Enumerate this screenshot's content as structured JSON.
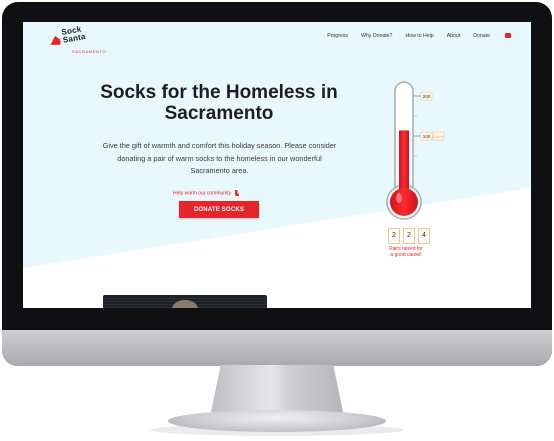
{
  "nav": {
    "logo": {
      "line1": "Sock",
      "line2": "Santa",
      "sub": "SACRAMENTO"
    },
    "links": [
      "Progress",
      "Why Donate?",
      "How to Help",
      "About",
      "Donate"
    ],
    "mail_icon": "envelope-icon"
  },
  "hero": {
    "title": "Socks for the Homeless in Sacramento",
    "description": "Give the gift of warmth and comfort this holiday season. Please consider donating a pair of warm socks to the homeless in our wonderful Sacramento area.",
    "help_link": "Help warm our community",
    "donate_button": "DONATE SOCKS"
  },
  "thermometer": {
    "max_label": "200",
    "mid_label": "100",
    "mid_note": "Good!",
    "fill_fraction": 0.6,
    "digits": [
      "2",
      "2",
      "4"
    ],
    "caption_line1": "Pairs raised for",
    "caption_line2": "a good cause!"
  },
  "colors": {
    "accent": "#e4252a",
    "hero_bg": "#e9f8fd",
    "text": "#1e1e1e"
  }
}
